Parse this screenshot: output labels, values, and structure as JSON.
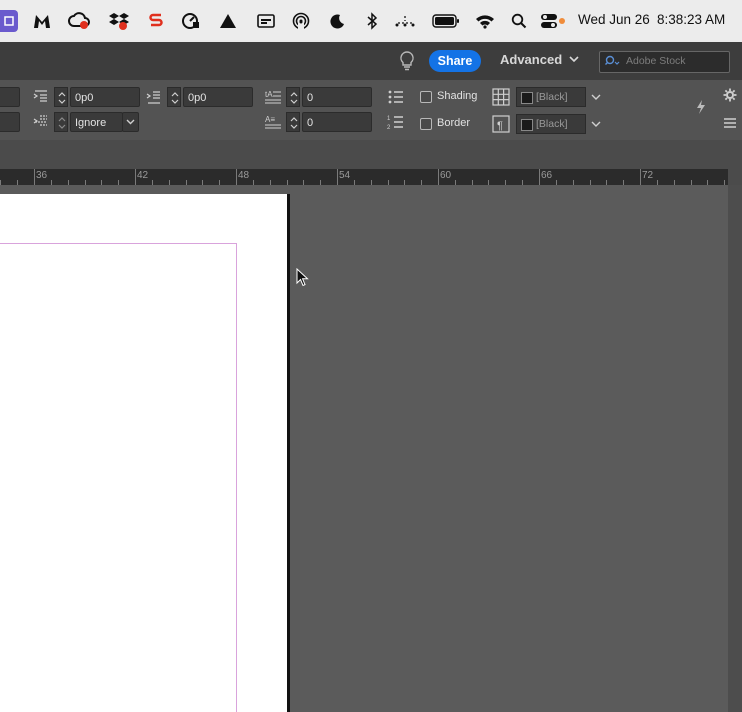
{
  "menubar": {
    "date": "Wed Jun 26",
    "time": "8:38:23 AM",
    "icons": [
      "app-icon",
      "malwarebytes-icon",
      "creative-cloud-icon",
      "dropbox-icon",
      "s-app-icon",
      "speed-icon",
      "triangle-icon",
      "display-icon",
      "airdrop-icon",
      "moon-icon",
      "bluetooth-icon",
      "network-icon",
      "battery-icon",
      "wifi-icon",
      "spotlight-icon",
      "control-center-icon"
    ]
  },
  "appbar": {
    "share_label": "Share",
    "workspace_label": "Advanced",
    "stock_placeholder": "Adobe Stock"
  },
  "control": {
    "space_before": "0p0",
    "space_after": "0p0",
    "align_to_grid": "Ignore",
    "drop_cap_lines": "0",
    "drop_cap_chars": "0",
    "shading_label": "Shading",
    "border_label": "Border",
    "shading_color": "[Black]",
    "border_color": "[Black]"
  },
  "ruler": {
    "labels": [
      "36",
      "42",
      "48",
      "54",
      "60",
      "66",
      "72"
    ]
  },
  "colors": {
    "accent": "#1473e6",
    "margin_guide": "#d9a3dc"
  }
}
